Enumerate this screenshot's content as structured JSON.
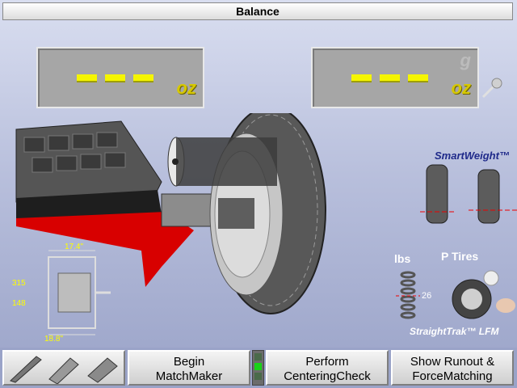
{
  "title": "Balance",
  "weights": {
    "left": {
      "display": "---",
      "unit": "oz"
    },
    "right": {
      "display": "---",
      "unit": "oz",
      "alt_unit": "g"
    }
  },
  "rim_diagram": {
    "width_top": "17.4\"",
    "offset": "315",
    "diameter": "148",
    "width_bottom": "18.8\""
  },
  "smartweight": {
    "title": "SmartWeight™"
  },
  "straighttrak": {
    "lbs_label": "lbs",
    "tires_label": "P Tires",
    "value": "26",
    "title": "StraightTrak™ LFM"
  },
  "toolbar": {
    "matchmaker": [
      "Begin",
      "MatchMaker"
    ],
    "centering": [
      "Perform",
      "CenteringCheck"
    ],
    "runout": [
      "Show Runout &",
      "ForceMatching"
    ]
  },
  "colors": {
    "weight_dash": "#f5f500",
    "indicator_green": "#19d219"
  },
  "icons": [
    "weight-clip-icon",
    "weight-strip-icon",
    "weight-1oz-icon",
    "probe-icon"
  ]
}
